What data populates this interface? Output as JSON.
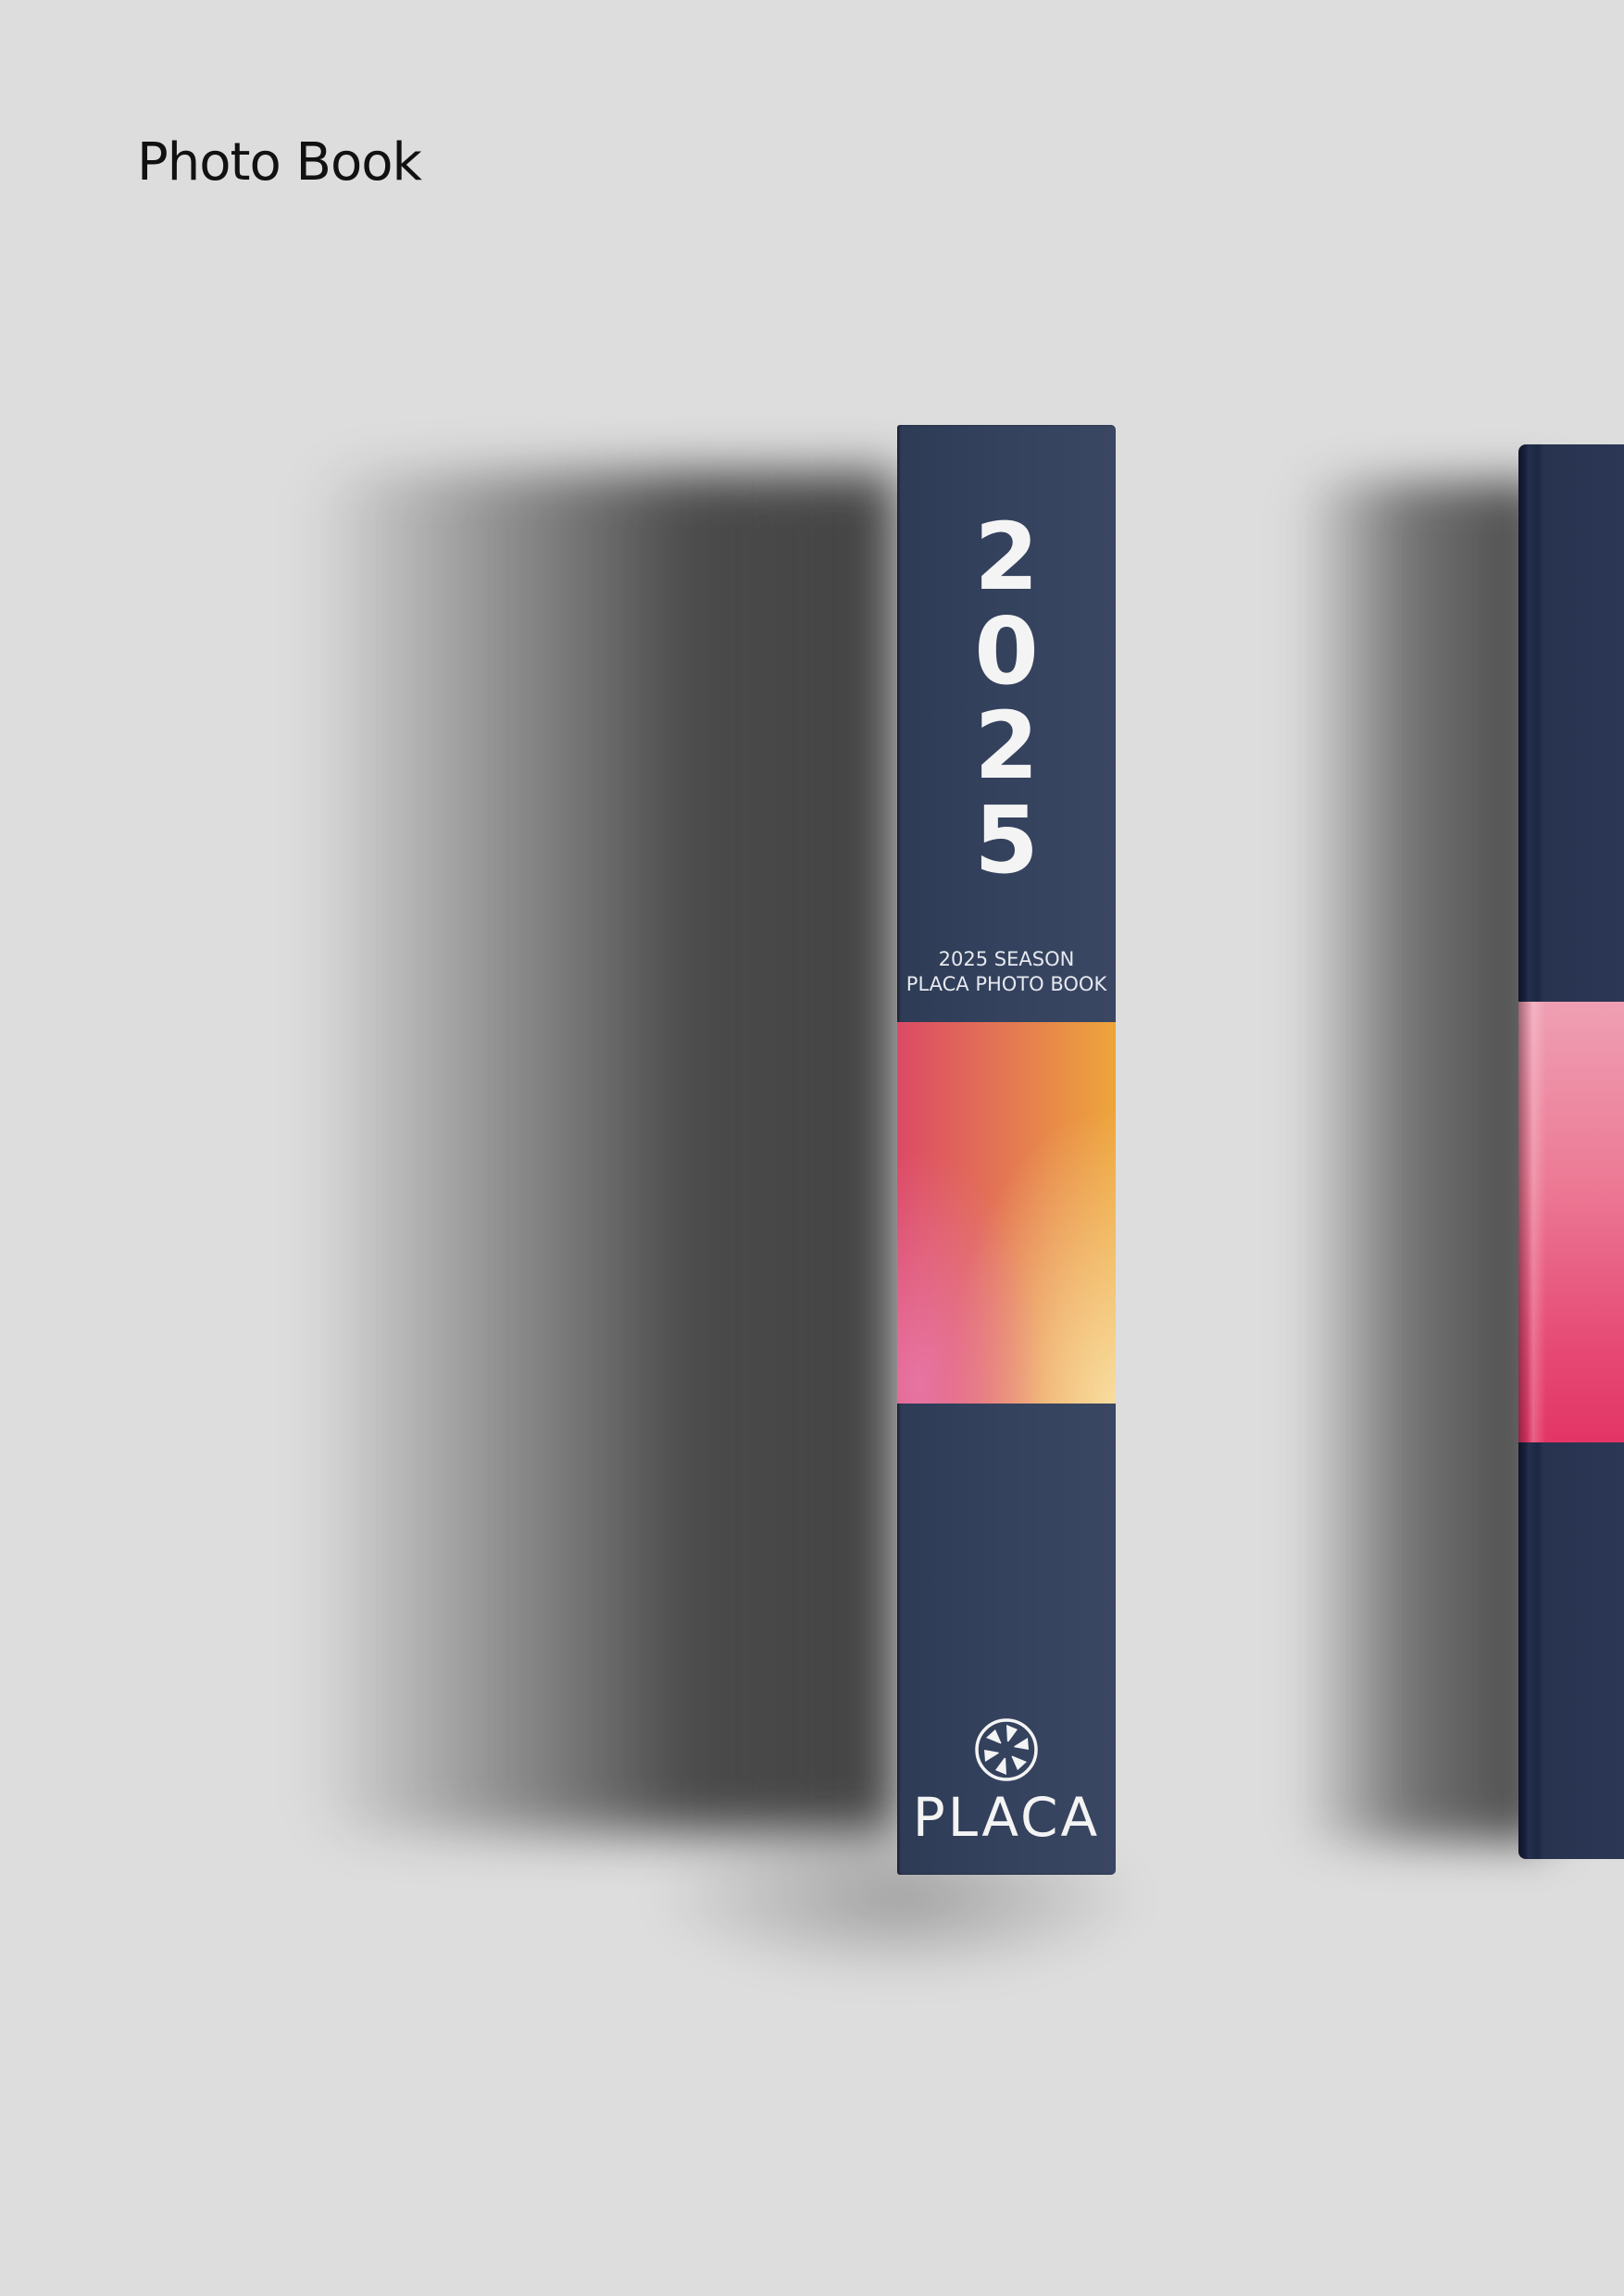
{
  "page": {
    "title": "Photo Book"
  },
  "spine": {
    "year_digits": [
      "2",
      "0",
      "2",
      "5"
    ],
    "subtitle_line1": "2025 SEASON",
    "subtitle_line2": "PLACA PHOTO BOOK",
    "brand": "PLACA",
    "logo_icon": "camera-aperture-icon"
  },
  "colors": {
    "background": "#dddddd",
    "spine_navy": "#34425e",
    "gradient_pink": "#dc4a66",
    "gradient_orange": "#eea53a",
    "gradient_cream": "#f8dca0",
    "second_band_pink": "#e64a75",
    "text_light": "#f4f4f4"
  }
}
